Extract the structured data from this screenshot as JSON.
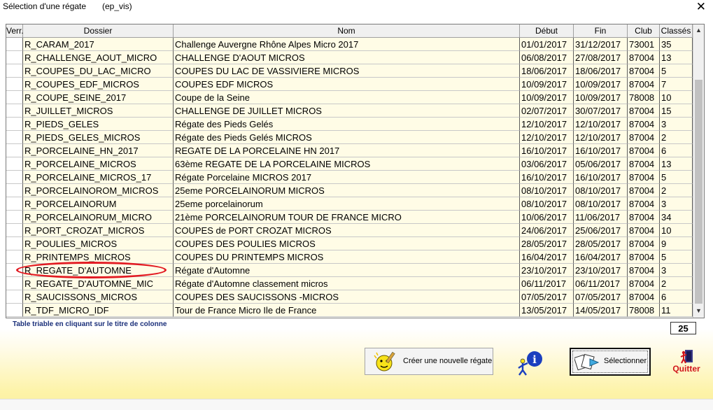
{
  "window": {
    "title": "Sélection d'une régate",
    "subtitle": "(ep_vis)",
    "close_glyph": "✕"
  },
  "table": {
    "headers": [
      "Verr.",
      "Dossier",
      "Nom",
      "Début",
      "Fin",
      "Club",
      "Classés"
    ],
    "rows": [
      [
        "",
        "R_CARAM_2017",
        "Challenge Auvergne Rhône Alpes Micro 2017",
        "01/01/2017",
        "31/12/2017",
        "73001",
        "35"
      ],
      [
        "",
        "R_CHALLENGE_AOUT_MICRO",
        "CHALLENGE D'AOUT MICROS",
        "06/08/2017",
        "27/08/2017",
        "87004",
        "13"
      ],
      [
        "",
        "R_COUPES_DU_LAC_MICRO",
        "COUPES DU LAC DE VASSIVIERE MICROS",
        "18/06/2017",
        "18/06/2017",
        "87004",
        "5"
      ],
      [
        "",
        "R_COUPES_EDF_MICROS",
        "COUPES EDF MICROS",
        "10/09/2017",
        "10/09/2017",
        "87004",
        "7"
      ],
      [
        "",
        "R_COUPE_SEINE_2017",
        "Coupe de la Seine",
        "10/09/2017",
        "10/09/2017",
        "78008",
        "10"
      ],
      [
        "",
        "R_JUILLET_MICROS",
        "CHALLENGE DE JUILLET MICROS",
        "02/07/2017",
        "30/07/2017",
        "87004",
        "15"
      ],
      [
        "",
        "R_PIEDS_GELES",
        "Régate des Pieds Gelés",
        "12/10/2017",
        "12/10/2017",
        "87004",
        "3"
      ],
      [
        "",
        "R_PIEDS_GELES_MICROS",
        "Régate des Pieds Gelés MICROS",
        "12/10/2017",
        "12/10/2017",
        "87004",
        "2"
      ],
      [
        "",
        "R_PORCELAINE_HN_2017",
        "REGATE DE LA PORCELAINE  HN 2017",
        "16/10/2017",
        "16/10/2017",
        "87004",
        "6"
      ],
      [
        "",
        "R_PORCELAINE_MICROS",
        "63ème REGATE DE LA PORCELAINE MICROS",
        "03/06/2017",
        "05/06/2017",
        "87004",
        "13"
      ],
      [
        "",
        "R_PORCELAINE_MICROS_17",
        "Régate Porcelaine MICROS 2017",
        "16/10/2017",
        "16/10/2017",
        "87004",
        "5"
      ],
      [
        "",
        "R_PORCELAINOROM_MICROS",
        "25eme PORCELAINORUM MICROS",
        "08/10/2017",
        "08/10/2017",
        "87004",
        "2"
      ],
      [
        "",
        "R_PORCELAINORUM",
        "25eme porcelainorum",
        "08/10/2017",
        "08/10/2017",
        "87004",
        "3"
      ],
      [
        "",
        "R_PORCELAINORUM_MICRO",
        "21ème PORCELAINORUM TOUR DE FRANCE MICRO",
        "10/06/2017",
        "11/06/2017",
        "87004",
        "34"
      ],
      [
        "",
        "R_PORT_CROZAT_MICROS",
        "COUPES de PORT CROZAT MICROS",
        "24/06/2017",
        "25/06/2017",
        "87004",
        "10"
      ],
      [
        "",
        "R_POULIES_MICROS",
        "COUPES DES POULIES MICROS",
        "28/05/2017",
        "28/05/2017",
        "87004",
        "9"
      ],
      [
        "",
        "R_PRINTEMPS_MICROS",
        "COUPES DU PRINTEMPS MICROS",
        "16/04/2017",
        "16/04/2017",
        "87004",
        "5"
      ],
      [
        "",
        "R_REGATE_D'AUTOMNE",
        "Régate d'Automne",
        "23/10/2017",
        "23/10/2017",
        "87004",
        "3"
      ],
      [
        "",
        "R_REGATE_D'AUTOMNE_MIC",
        "Régate d'Automne classement micros",
        "06/11/2017",
        "06/11/2017",
        "87004",
        "2"
      ],
      [
        "",
        "R_SAUCISSONS_MICROS",
        "COUPES DES SAUCISSONS -MICROS",
        "07/05/2017",
        "07/05/2017",
        "87004",
        "6"
      ],
      [
        "",
        "R_TDF_MICRO_IDF",
        "Tour de France Micro Ile de France",
        "13/05/2017",
        "14/05/2017",
        "78008",
        "11"
      ]
    ],
    "highlighted_row": 17
  },
  "scrollbar": {
    "up_glyph": "▲",
    "down_glyph": "▼"
  },
  "footer": {
    "hint": "Table triable en cliquant sur le titre de colonne",
    "count": "25"
  },
  "buttons": {
    "new_regatta": "Créer une nouvelle régate",
    "select": "Sélectionner",
    "quit": "Quitter"
  },
  "colors": {
    "highlight_ellipse": "#e21a22",
    "quit_red": "#d0151c",
    "row_tint": "#fffce6"
  },
  "icons": [
    "close-icon",
    "smiley-pencil-icon",
    "info-person-icon",
    "select-forms-icon",
    "exit-door-icon",
    "scroll-up-icon",
    "scroll-down-icon"
  ]
}
